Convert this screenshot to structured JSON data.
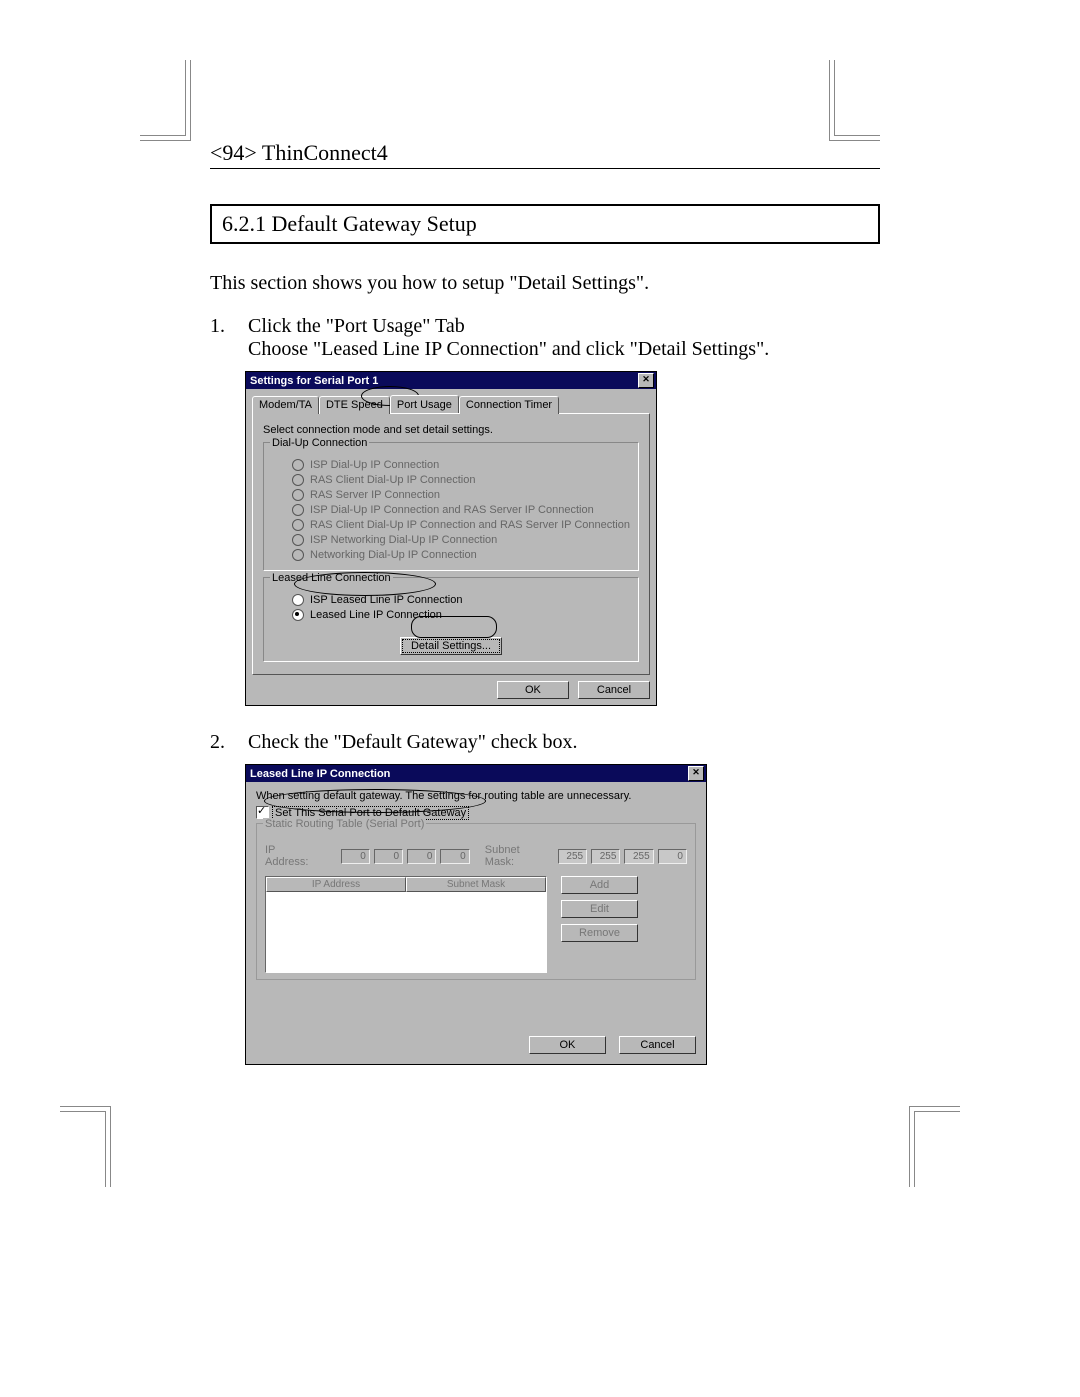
{
  "page_header": "<94> ThinConnect4",
  "section_title": "6.2.1 Default Gateway Setup",
  "intro": "This section shows you how to setup \"Detail Settings\".",
  "steps": {
    "one_num": "1.",
    "one_line1": "Click the \"Port Usage\" Tab",
    "one_line2": "Choose \"Leased Line IP Connection\" and click \"Detail Settings\".",
    "two_num": "2.",
    "two_line1": "Check the \"Default Gateway\" check box."
  },
  "dialog1": {
    "title": "Settings for Serial Port 1",
    "tabs": {
      "t1": "Modem/TA",
      "t2": "DTE Speed",
      "t3": "Port Usage",
      "t4": "Connection Timer"
    },
    "instruction": "Select connection mode and set detail settings.",
    "group1_title": "Dial-Up Connection",
    "r1": "ISP Dial-Up IP Connection",
    "r2": "RAS Client Dial-Up IP Connection",
    "r3": "RAS Server IP Connection",
    "r4": "ISP Dial-Up IP Connection and RAS Server IP Connection",
    "r5": "RAS Client Dial-Up IP Connection and RAS Server IP Connection",
    "r6": "ISP Networking Dial-Up IP Connection",
    "r7": "Networking Dial-Up IP Connection",
    "group2_title": "Leased Line Connection",
    "r8": "ISP Leased Line IP Connection",
    "r9": "Leased Line IP Connection",
    "detail_btn": "Detail Settings...",
    "ok": "OK",
    "cancel": "Cancel"
  },
  "dialog2": {
    "title": "Leased Line IP Connection",
    "note": "When setting default gateway. The settings for routing table are unnecessary.",
    "checkbox_label": "Set This Serial Port to Default Gateway",
    "group_title": "Static Routing Table (Serial Port)",
    "ip_label": "IP Address:",
    "subnet_label": "Subnet Mask:",
    "ip_vals": [
      "0",
      "0",
      "0",
      "0"
    ],
    "mask_vals": [
      "255",
      "255",
      "255",
      "0"
    ],
    "th1": "IP Address",
    "th2": "Subnet Mask",
    "add": "Add",
    "edit": "Edit",
    "remove": "Remove",
    "ok": "OK",
    "cancel": "Cancel"
  }
}
